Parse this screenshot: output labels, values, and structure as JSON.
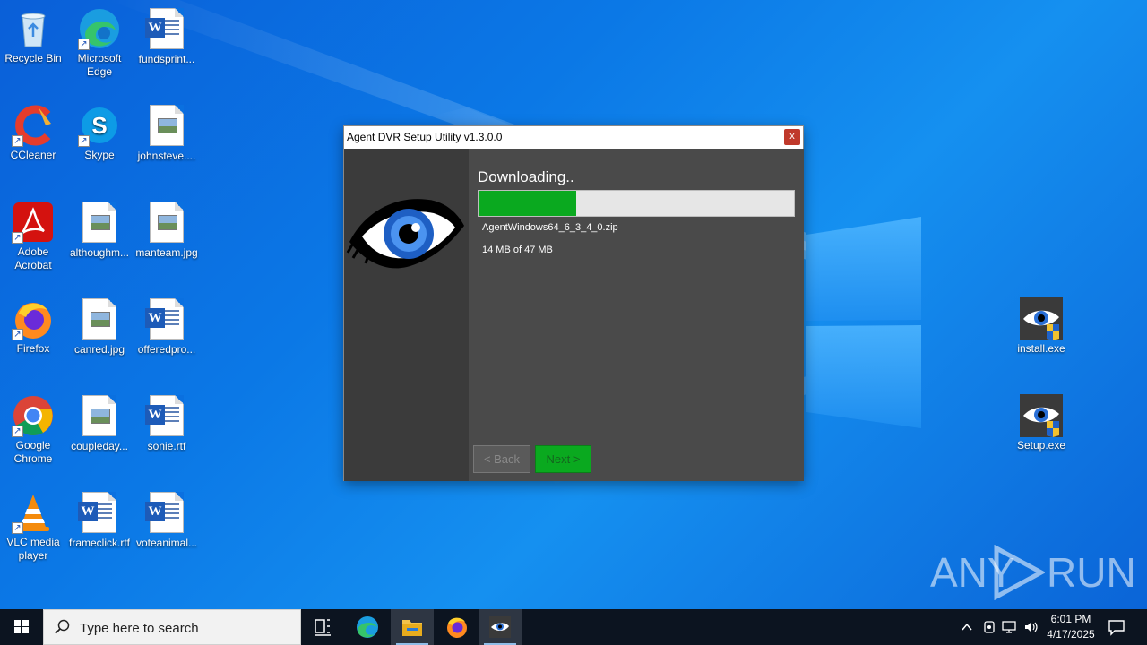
{
  "desktop": {
    "icons": [
      {
        "label": "Recycle Bin",
        "icon": "recycle-bin-icon"
      },
      {
        "label": "Microsoft Edge",
        "icon": "edge-icon"
      },
      {
        "label": "fundsprint...",
        "icon": "word-doc-icon"
      },
      {
        "label": "CCleaner",
        "icon": "ccleaner-icon"
      },
      {
        "label": "Skype",
        "icon": "skype-icon"
      },
      {
        "label": "johnsteve....",
        "icon": "image-file-icon"
      },
      {
        "label": "Adobe Acrobat",
        "icon": "acrobat-icon"
      },
      {
        "label": "althoughm...",
        "icon": "image-file-icon"
      },
      {
        "label": "manteam.jpg",
        "icon": "image-file-icon"
      },
      {
        "label": "Firefox",
        "icon": "firefox-icon"
      },
      {
        "label": "canred.jpg",
        "icon": "image-file-icon"
      },
      {
        "label": "offeredpro...",
        "icon": "word-doc-icon"
      },
      {
        "label": "Google Chrome",
        "icon": "chrome-icon"
      },
      {
        "label": "coupleday...",
        "icon": "image-file-icon"
      },
      {
        "label": "sonie.rtf",
        "icon": "word-doc-icon"
      },
      {
        "label": "VLC media player",
        "icon": "vlc-icon"
      },
      {
        "label": "frameclick.rtf",
        "icon": "word-doc-icon"
      },
      {
        "label": "voteanimal...",
        "icon": "word-doc-icon"
      },
      {
        "label": "install.exe",
        "icon": "agent-dvr-icon"
      },
      {
        "label": "Setup.exe",
        "icon": "agent-dvr-icon"
      }
    ]
  },
  "dialog": {
    "title": "Agent DVR Setup Utility v1.3.0.0",
    "close_label": "x",
    "heading": "Downloading..",
    "progress_fraction": 0.31,
    "file_name": "AgentWindows64_6_3_4_0.zip",
    "size_text": "14 MB of 47 MB",
    "back_label": "< Back",
    "next_label": "Next >"
  },
  "watermark": {
    "left": "ANY",
    "right": "RUN"
  },
  "taskbar": {
    "search_placeholder": "Type here to search",
    "time": "6:01 PM",
    "date": "4/17/2025"
  },
  "colors": {
    "progress_fill": "#0aa91f",
    "wallpaper": "#0b78e6",
    "taskbar": "#0c1420"
  }
}
